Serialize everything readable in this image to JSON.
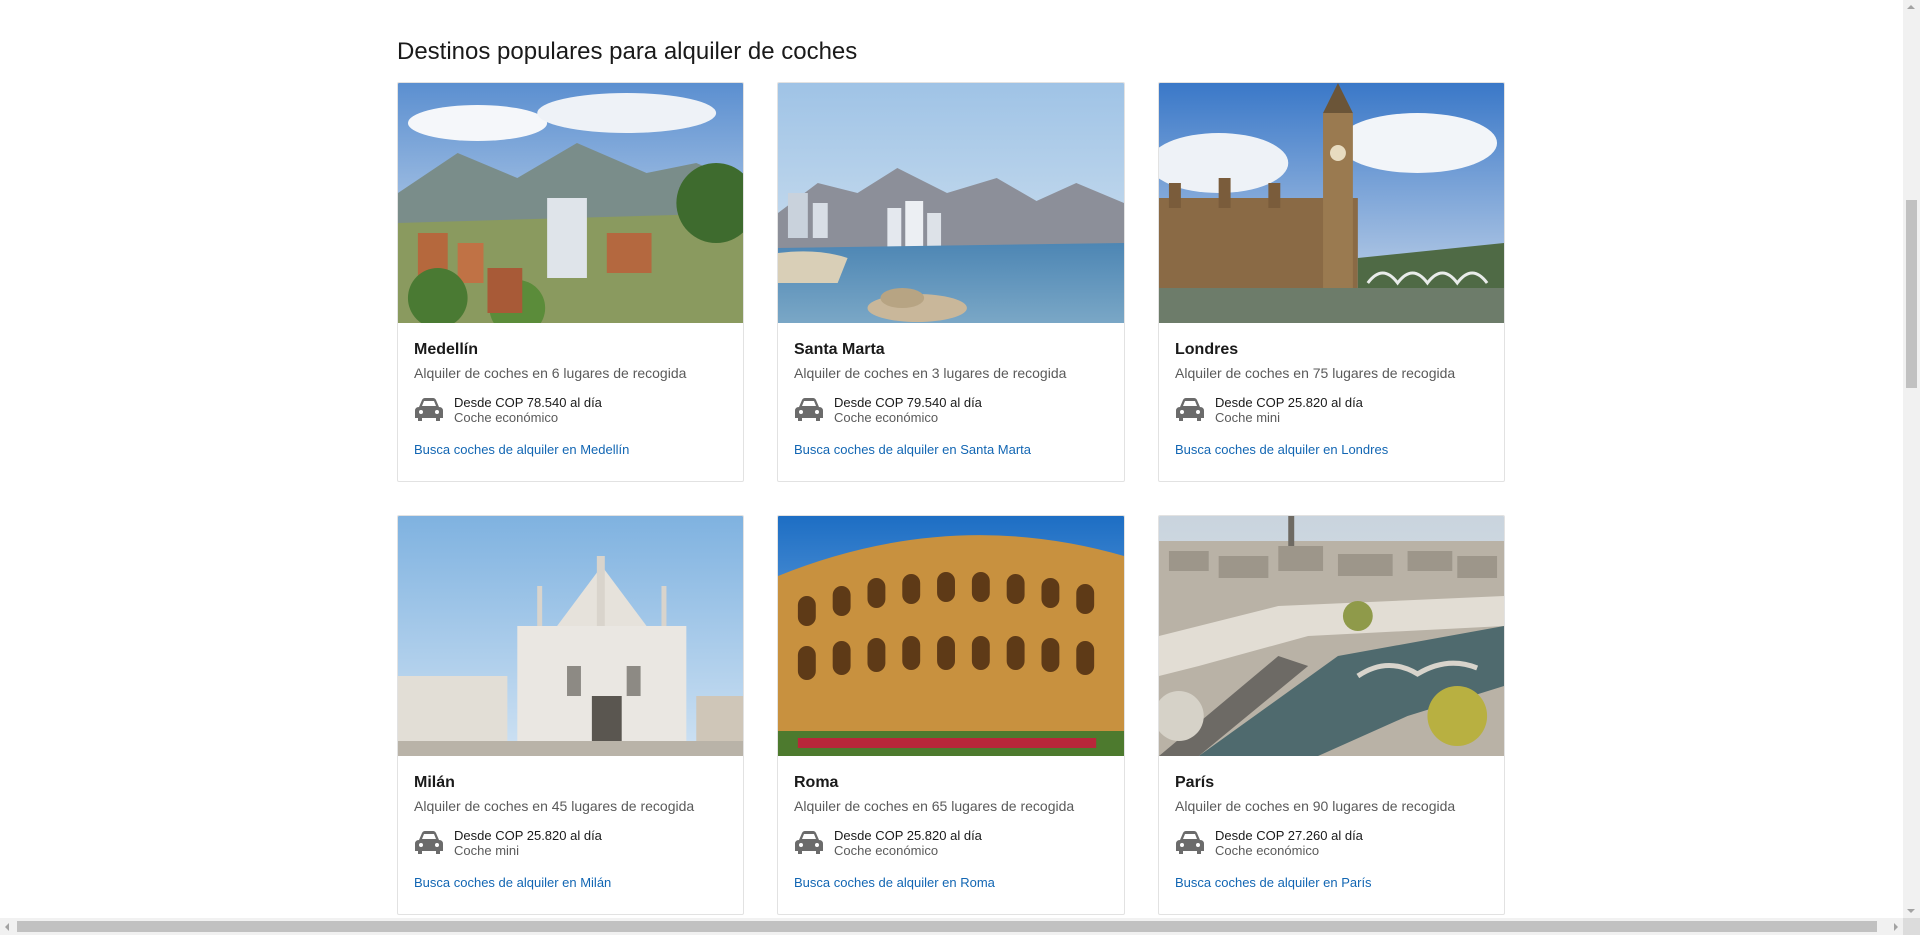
{
  "section": {
    "title": "Destinos populares para alquiler de coches"
  },
  "colors": {
    "link": "#1266b3",
    "muted_text": "#5a5a5a",
    "card_border": "#e2e2e2"
  },
  "icons": {
    "car": "car-icon"
  },
  "cards": [
    {
      "city": "Medellín",
      "subtitle": "Alquiler de coches en 6 lugares de recogida",
      "price": "Desde COP 78.540 al día",
      "car_type": "Coche económico",
      "link": "Busca coches de alquiler en Medellín"
    },
    {
      "city": "Santa Marta",
      "subtitle": "Alquiler de coches en 3 lugares de recogida",
      "price": "Desde COP 79.540 al día",
      "car_type": "Coche económico",
      "link": "Busca coches de alquiler en Santa Marta"
    },
    {
      "city": "Londres",
      "subtitle": "Alquiler de coches en 75 lugares de recogida",
      "price": "Desde COP 25.820 al día",
      "car_type": "Coche mini",
      "link": "Busca coches de alquiler en Londres"
    },
    {
      "city": "Milán",
      "subtitle": "Alquiler de coches en 45 lugares de recogida",
      "price": "Desde COP 25.820 al día",
      "car_type": "Coche mini",
      "link": "Busca coches de alquiler en Milán"
    },
    {
      "city": "Roma",
      "subtitle": "Alquiler de coches en 65 lugares de recogida",
      "price": "Desde COP 25.820 al día",
      "car_type": "Coche económico",
      "link": "Busca coches de alquiler en Roma"
    },
    {
      "city": "París",
      "subtitle": "Alquiler de coches en 90 lugares de recogida",
      "price": "Desde COP 27.260 al día",
      "car_type": "Coche económico",
      "link": "Busca coches de alquiler en París"
    }
  ]
}
